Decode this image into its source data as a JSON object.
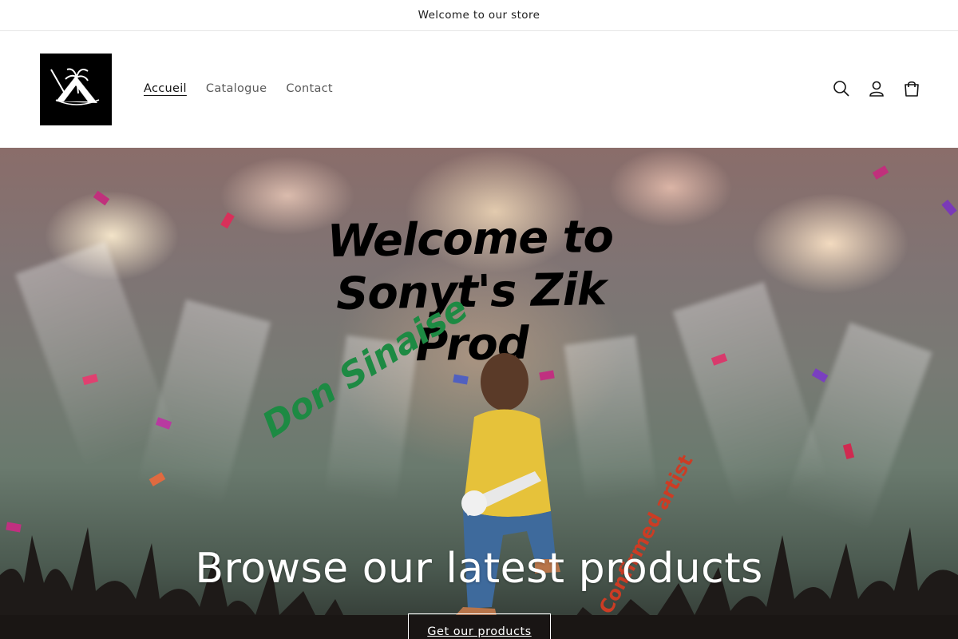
{
  "announcement": {
    "text": "Welcome to our store"
  },
  "header": {
    "logo_alt": "Sonyt's Zik Prod",
    "nav": [
      {
        "label": "Accueil",
        "active": true
      },
      {
        "label": "Catalogue",
        "active": false
      },
      {
        "label": "Contact",
        "active": false
      }
    ],
    "icons": [
      "search-icon",
      "account-icon",
      "cart-icon"
    ]
  },
  "hero": {
    "art_title_line1": "Welcome to",
    "art_title_line2": "Sonyt's Zik Prod",
    "artist_name": "Don Sinaise",
    "artist_tag": "Confirmed artist",
    "heading": "Browse our latest products",
    "button_label": "Get our products"
  },
  "colors": {
    "text": "#121212",
    "nav_muted": "#5a5a5a",
    "artist_green": "#1d8a43",
    "tag_red": "#cc3c24",
    "hero_text": "#ffffff"
  }
}
